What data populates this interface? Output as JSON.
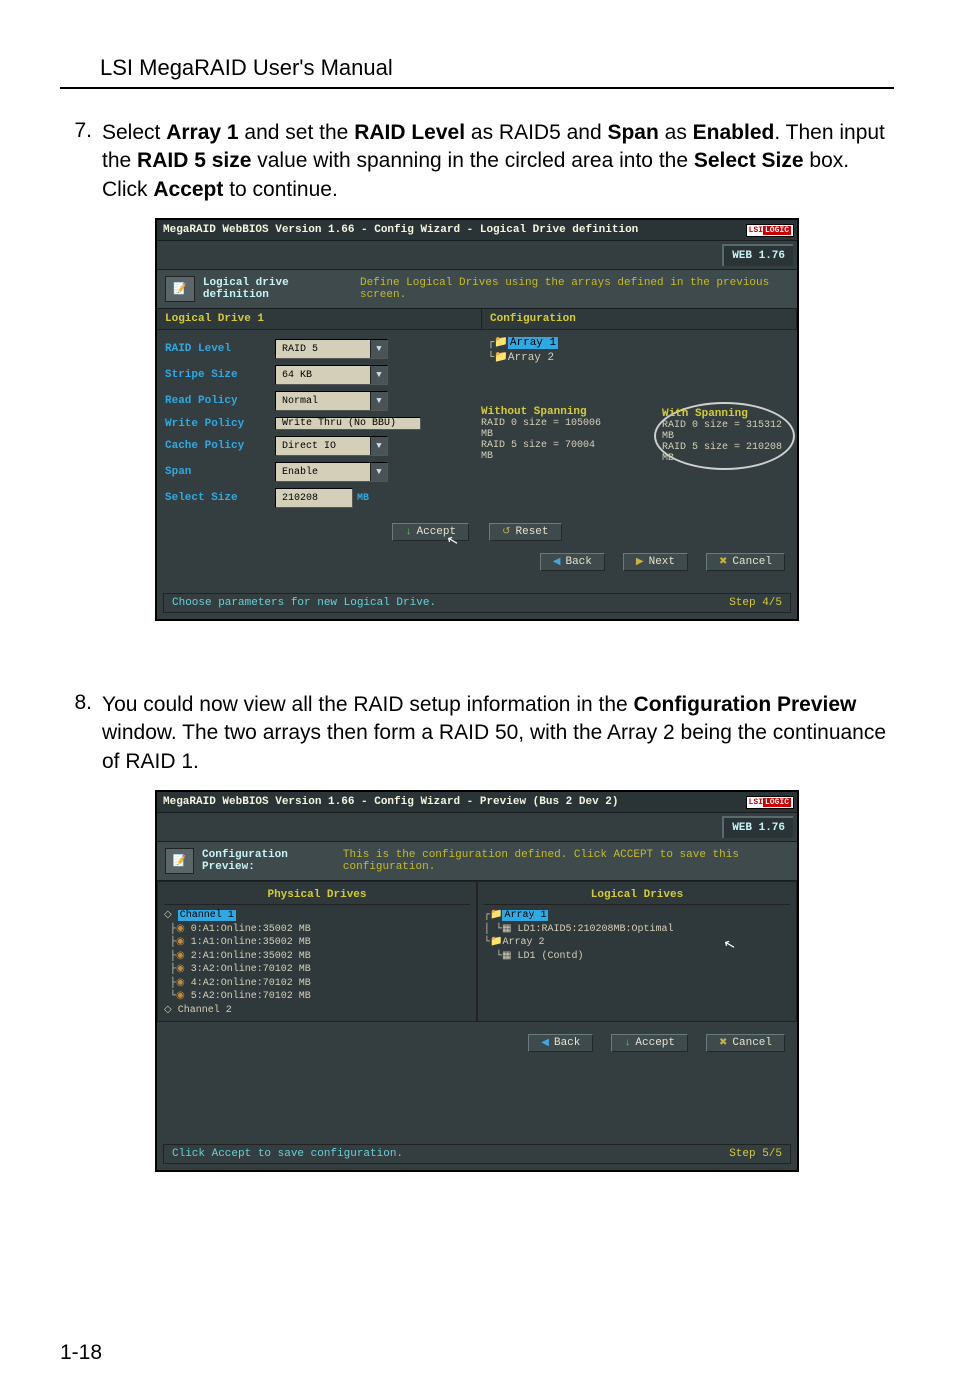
{
  "doc_title": "LSI MegaRAID User's Manual",
  "page_number": "1-18",
  "step7": {
    "num": "7.",
    "parts": [
      "Select ",
      {
        "b": "Array 1"
      },
      " and set the ",
      {
        "b": "RAID Level"
      },
      " as RAID5 and ",
      {
        "b": "Span"
      },
      " as ",
      {
        "b": "Enabled"
      },
      ". Then input the ",
      {
        "b": "RAID 5 size"
      },
      " value with spanning in the circled area into the ",
      {
        "b": "Select Size"
      },
      " box. Click ",
      {
        "b": "Accept"
      },
      " to continue."
    ]
  },
  "step8": {
    "num": "8.",
    "parts": [
      "You could now view all the RAID setup information in the ",
      {
        "b": "Configuration Preview"
      },
      " window. The two arrays then form a RAID 50, with the Array 2 being the continuance of RAID 1."
    ]
  },
  "shot1": {
    "title": "MegaRAID WebBIOS Version 1.66 - Config Wizard - Logical Drive definition",
    "lsi_prefix": "LSI",
    "lsi_suffix": "LOGIC",
    "webver": "WEB 1.76",
    "subheader_label": "Logical drive definition",
    "subheader_desc": "Define Logical Drives using the arrays defined in the previous screen.",
    "left_panel_title": "Logical Drive 1",
    "right_panel_title": "Configuration",
    "fields": {
      "raid_level": {
        "label": "RAID Level",
        "value": "RAID 5"
      },
      "stripe_size": {
        "label": "Stripe Size",
        "value": "64 KB"
      },
      "read_policy": {
        "label": "Read Policy",
        "value": "Normal"
      },
      "write_policy": {
        "label": "Write Policy",
        "value": "Write Thru (No BBU)"
      },
      "cache_policy": {
        "label": "Cache Policy",
        "value": "Direct IO"
      },
      "span": {
        "label": "Span",
        "value": "Enable"
      },
      "select_size": {
        "label": "Select Size",
        "value": "210208",
        "unit": "MB"
      }
    },
    "tree": {
      "a1": "Array 1",
      "a2": "Array 2"
    },
    "spanning": {
      "without_title": "Without Spanning",
      "without_l1": "RAID 0 size = 105006 MB",
      "without_l2": "RAID 5 size = 70004 MB",
      "with_title": "With Spanning",
      "with_l1": "RAID 0 size = 315312 MB",
      "with_l2": "RAID 5 size = 210208 MB"
    },
    "buttons": {
      "accept": "Accept",
      "reset": "Reset",
      "back": "Back",
      "next": "Next",
      "cancel": "Cancel"
    },
    "footer_left": "Choose parameters for new Logical Drive.",
    "footer_right": "Step 4/5"
  },
  "shot2": {
    "title": "MegaRAID WebBIOS Version 1.66 - Config Wizard - Preview (Bus 2 Dev 2)",
    "webver": "WEB 1.76",
    "subheader_label": "Configuration Preview:",
    "subheader_desc": "This is the configuration defined. Click ACCEPT to save this configuration.",
    "phys_title": "Physical Drives",
    "log_title": "Logical Drives",
    "phys_lines": {
      "ch1": "Channel 1",
      "d0": "0:A1:Online:35002 MB",
      "d1": "1:A1:Online:35002 MB",
      "d2": "2:A1:Online:35002 MB",
      "d3": "3:A2:Online:70102 MB",
      "d4": "4:A2:Online:70102 MB",
      "d5": "5:A2:Online:70102 MB",
      "ch2": "Channel 2"
    },
    "log_lines": {
      "a1": "Array 1",
      "ld1": "LD1:RAID5:210208MB:Optimal",
      "a2": "Array 2",
      "ld1c": "LD1 (Contd)"
    },
    "buttons": {
      "back": "Back",
      "accept": "Accept",
      "cancel": "Cancel"
    },
    "footer_left": "Click Accept to save configuration.",
    "footer_right": "Step 5/5"
  }
}
